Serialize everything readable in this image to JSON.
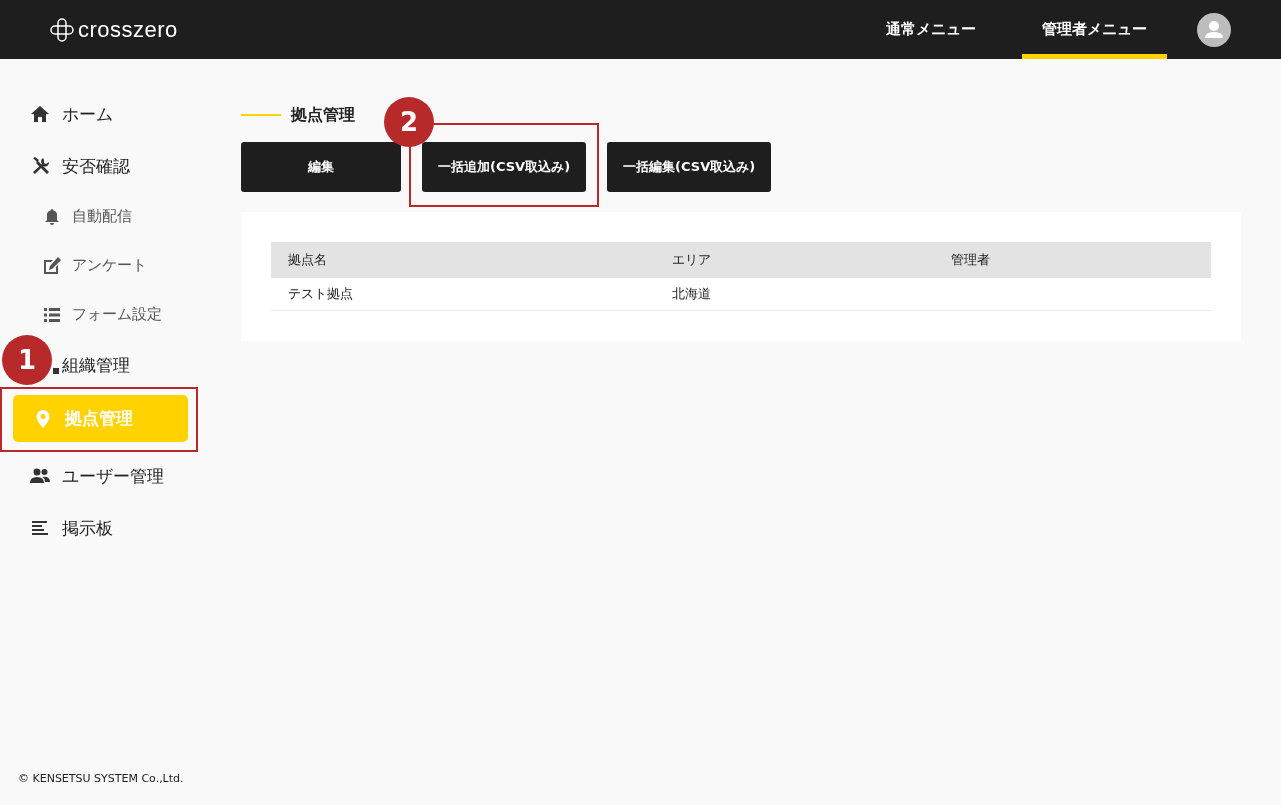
{
  "header": {
    "logo": "crosszero",
    "nav": [
      {
        "label": "通常メニュー",
        "selected": false
      },
      {
        "label": "管理者メニュー",
        "selected": true
      }
    ]
  },
  "sidebar": {
    "items": [
      {
        "label": "ホーム",
        "kind": "main",
        "selected": false
      },
      {
        "label": "安否確認",
        "kind": "main",
        "selected": false
      },
      {
        "label": "自動配信",
        "kind": "sub",
        "selected": false
      },
      {
        "label": "アンケート",
        "kind": "sub",
        "selected": false
      },
      {
        "label": "フォーム設定",
        "kind": "sub",
        "selected": false
      },
      {
        "label": "組織管理",
        "kind": "main",
        "selected": false
      },
      {
        "label": "拠点管理",
        "kind": "main",
        "selected": true,
        "callout": "1"
      },
      {
        "label": "ユーザー管理",
        "kind": "main",
        "selected": false
      },
      {
        "label": "掲示板",
        "kind": "main",
        "selected": false
      }
    ]
  },
  "page": {
    "title": "拠点管理",
    "buttons": [
      {
        "label": "編集"
      },
      {
        "label": "一括追加(CSV取込み)",
        "callout": "2"
      },
      {
        "label": "一括編集(CSV取込み)"
      }
    ]
  },
  "table": {
    "columns": [
      "拠点名",
      "エリア",
      "管理者"
    ],
    "rows": [
      [
        "テスト拠点",
        "北海道",
        ""
      ]
    ]
  },
  "footer": "© KENSETSU SYSTEM Co.,Ltd."
}
